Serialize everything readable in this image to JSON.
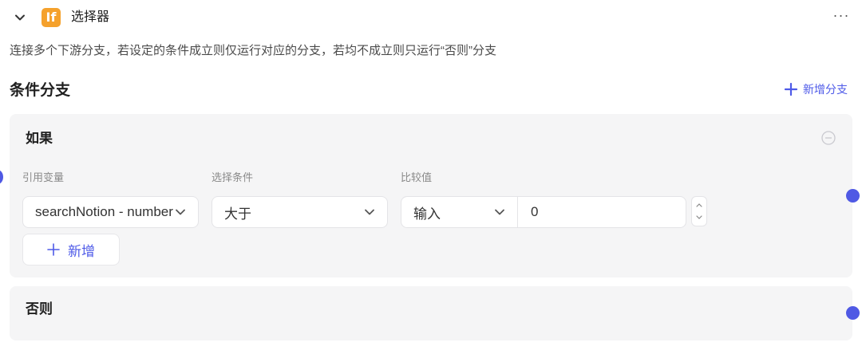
{
  "node": {
    "icon_text": "If",
    "icon_color": "#f5a12c",
    "title": "选择器",
    "more_label": "···",
    "description": "连接多个下游分支，若设定的条件成立则仅运行对应的分支，若均不成立则只运行“否则”分支"
  },
  "section": {
    "title": "条件分支",
    "add_branch_label": "新增分支"
  },
  "if_branch": {
    "title": "如果",
    "labels": {
      "variable": "引用变量",
      "condition": "选择条件",
      "compare": "比较值"
    },
    "variable_value": "searchNotion - number",
    "condition_value": "大于",
    "compare_type": "输入",
    "compare_value": "0",
    "add_label": "新增"
  },
  "else_branch": {
    "title": "否则"
  },
  "colors": {
    "accent": "#4e5ae8",
    "handle": "#4f59e4",
    "card_bg": "#f5f5f6"
  },
  "icons": [
    "chevron-down-icon",
    "if-node-icon",
    "more-icon",
    "plus-icon",
    "minus-circle-icon",
    "stepper-icon",
    "connection-handle"
  ]
}
